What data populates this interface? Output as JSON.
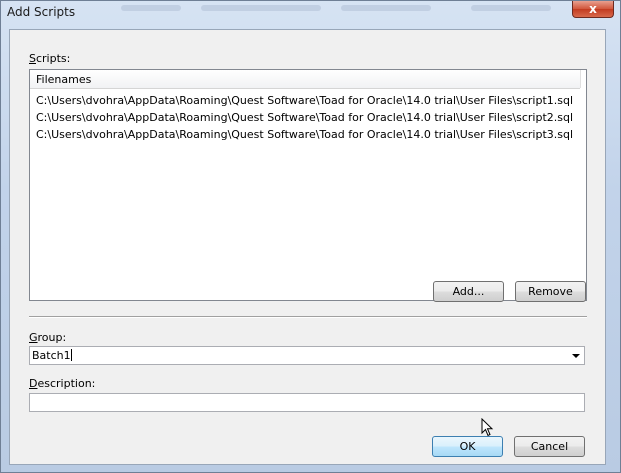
{
  "window": {
    "title": "Add Scripts",
    "close_glyph": "x"
  },
  "scripts": {
    "label_prefix": "S",
    "label_rest": "cripts:",
    "column_header": "Filenames",
    "files": [
      "C:\\Users\\dvohra\\AppData\\Roaming\\Quest Software\\Toad for Oracle\\14.0 trial\\User Files\\script1.sql",
      "C:\\Users\\dvohra\\AppData\\Roaming\\Quest Software\\Toad for Oracle\\14.0 trial\\User Files\\script2.sql",
      "C:\\Users\\dvohra\\AppData\\Roaming\\Quest Software\\Toad for Oracle\\14.0 trial\\User Files\\script3.sql"
    ],
    "add_label": "Add...",
    "remove_label": "Remove"
  },
  "group": {
    "label_prefix": "G",
    "label_rest": "roup:",
    "value": "Batch1"
  },
  "description": {
    "label_prefix": "D",
    "label_rest": "escription:",
    "value": ""
  },
  "footer": {
    "ok_label": "OK",
    "cancel_label": "Cancel"
  }
}
